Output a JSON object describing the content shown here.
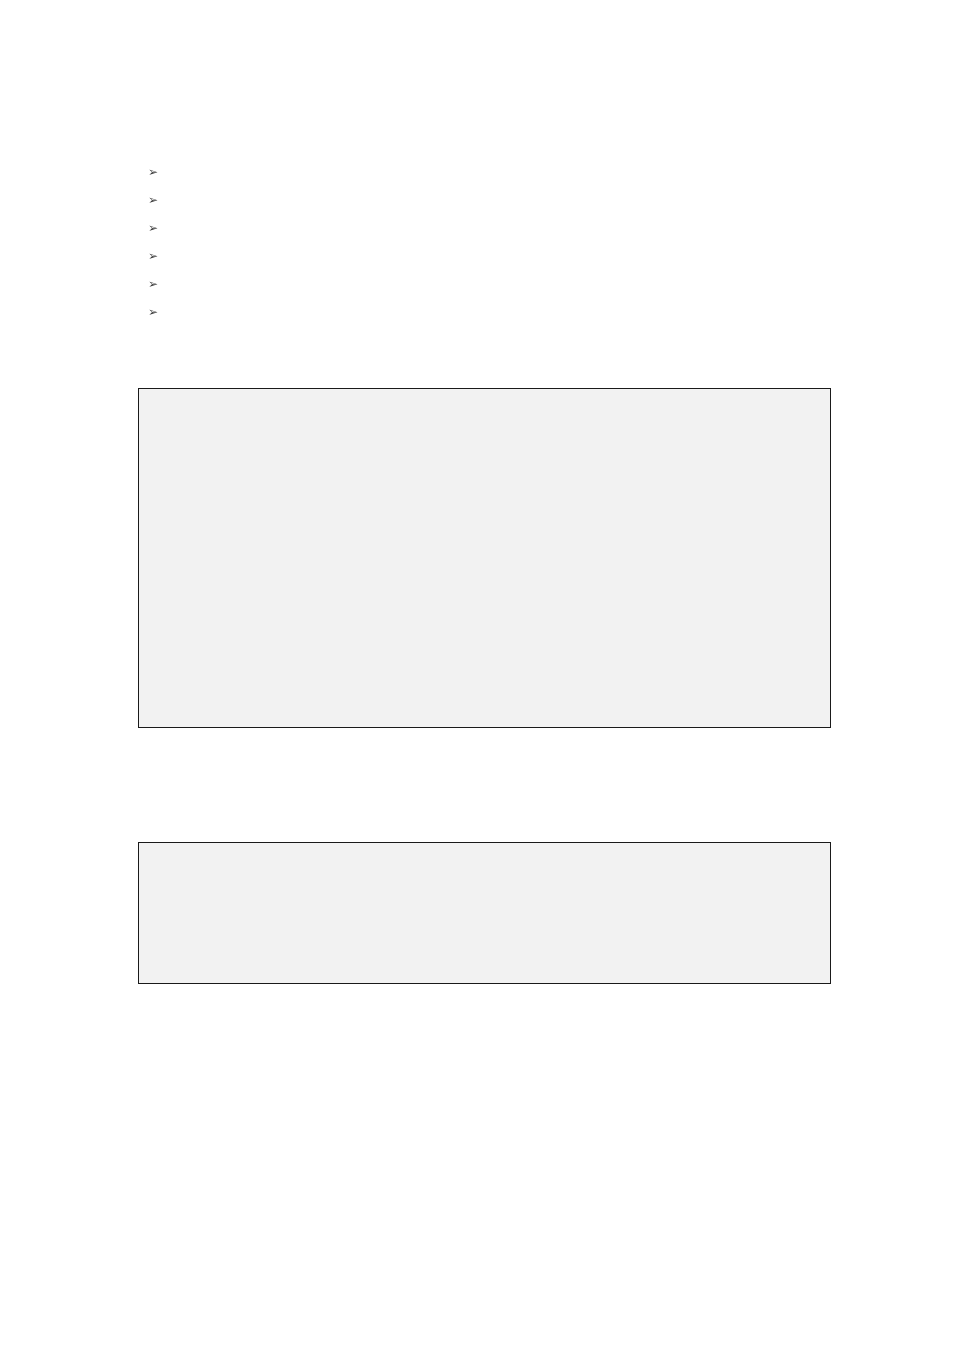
{
  "bullets": {
    "items": [
      "",
      "",
      "",
      "",
      "",
      ""
    ],
    "glyph": "➢"
  },
  "boxes": {
    "box1": {
      "content": ""
    },
    "box2": {
      "content": ""
    }
  }
}
